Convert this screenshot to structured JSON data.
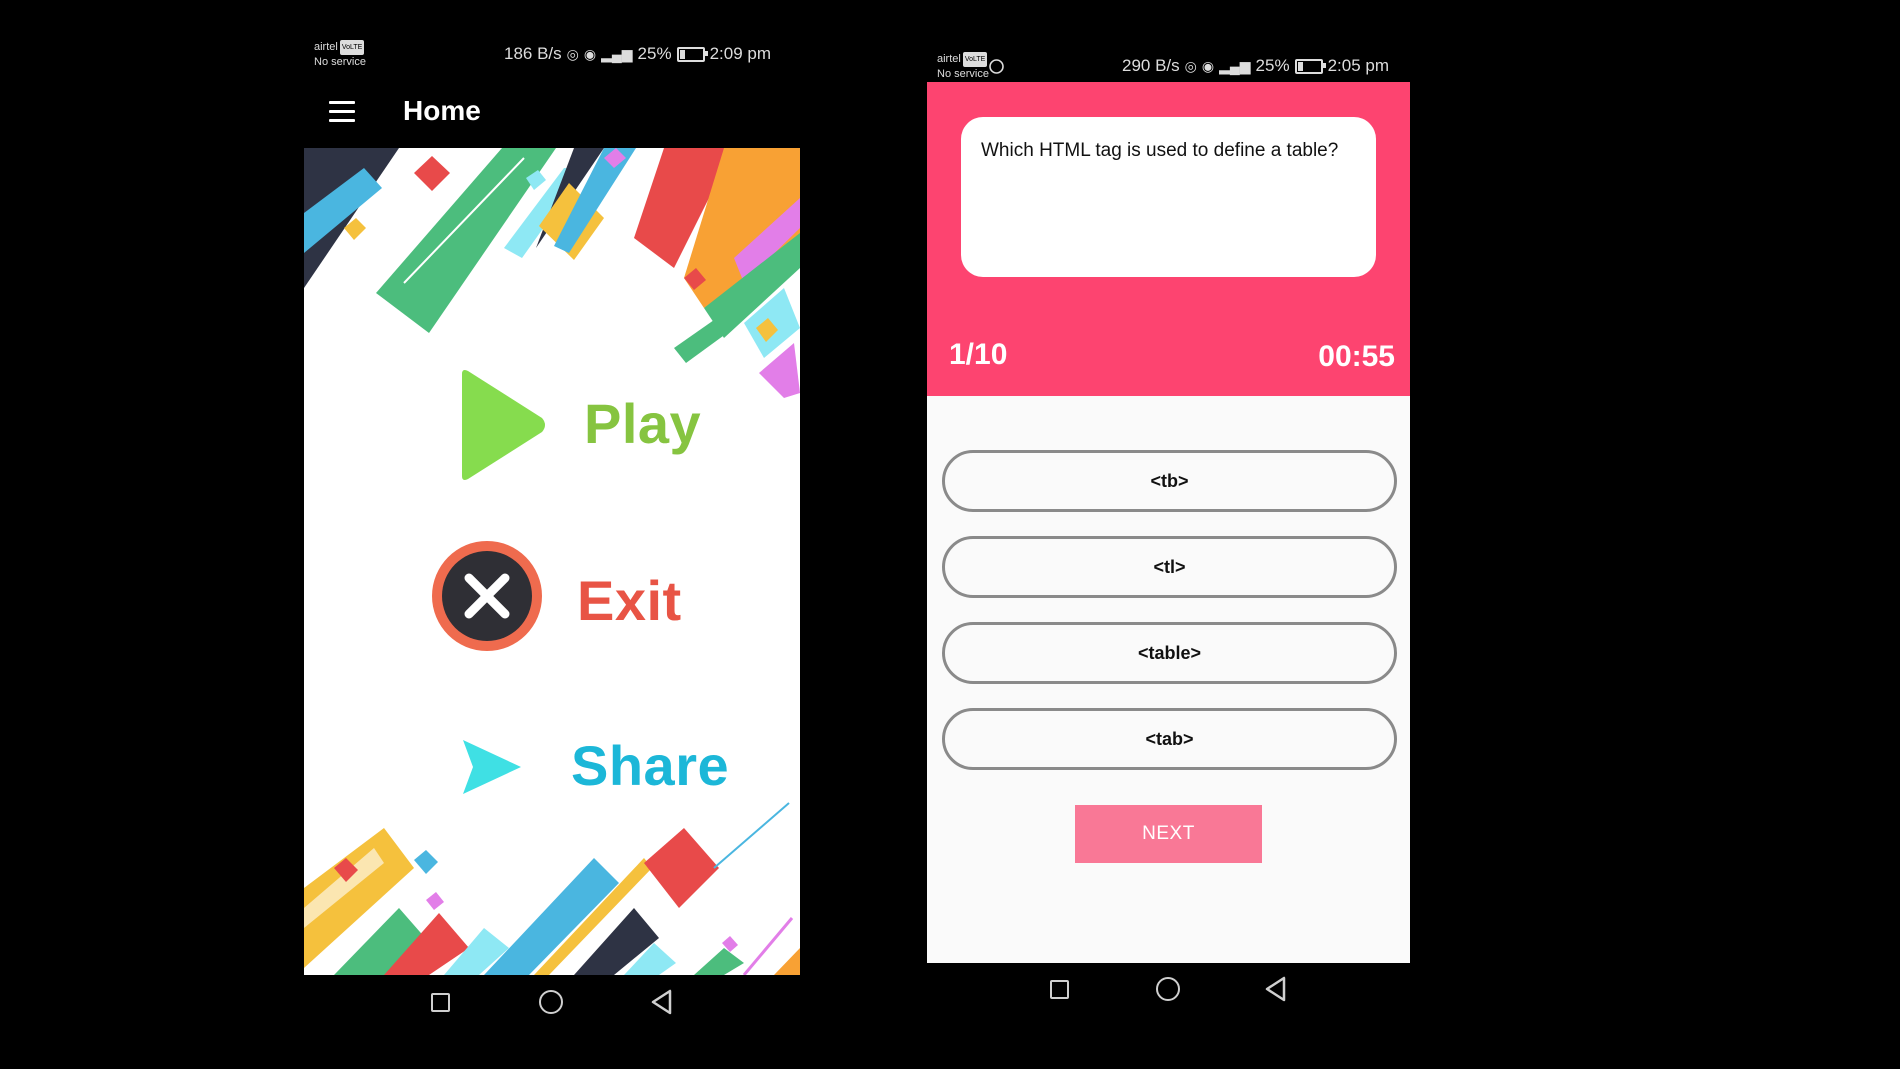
{
  "left_phone": {
    "status": {
      "carrier": "airtel",
      "network_badge": "VoLTE",
      "service": "No service",
      "speed": "186 B/s",
      "battery": "25%",
      "time": "2:09 pm"
    },
    "toolbar": {
      "title": "Home"
    },
    "menu": {
      "play_label": "Play",
      "exit_label": "Exit",
      "share_label": "Share"
    },
    "icons": [
      "menu-icon",
      "play-icon",
      "exit-icon",
      "share-icon"
    ],
    "colors": {
      "play": "#86c440",
      "exit": "#e85445",
      "share": "#1cb7d8"
    }
  },
  "right_phone": {
    "status": {
      "carrier": "airtel",
      "network_badge": "VoLTE",
      "service": "No service",
      "speed": "290 B/s",
      "battery": "25%",
      "time": "2:05 pm"
    },
    "question": "Which HTML tag is used to define a table?",
    "progress": "1/10",
    "timer": "00:55",
    "options": [
      "<tb>",
      "<tl>",
      "<table>",
      "<tab>"
    ],
    "next_label": "NEXT",
    "colors": {
      "header": "#fd4470",
      "next_button": "#f97896"
    }
  },
  "nav_bar": {
    "icons": [
      "recent-apps-icon",
      "home-icon",
      "back-icon"
    ]
  }
}
